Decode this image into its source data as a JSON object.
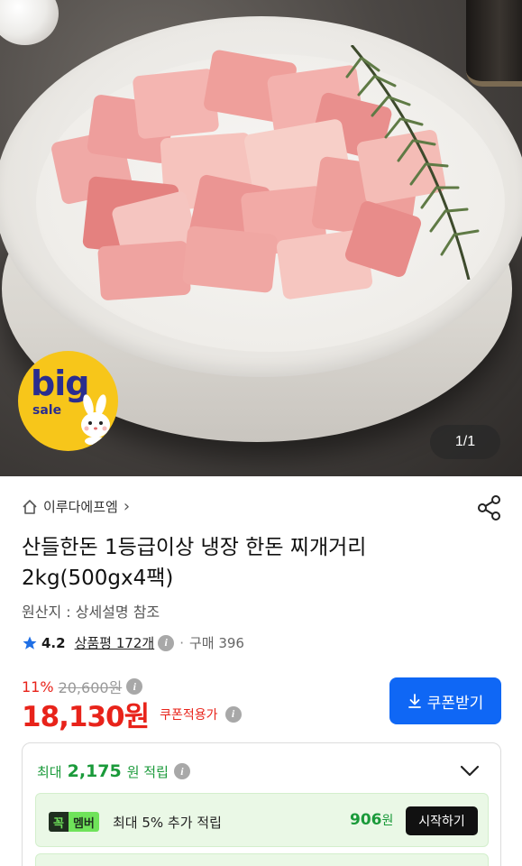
{
  "hero": {
    "badge_big": "big",
    "badge_sale": "sale",
    "image_counter": "1/1"
  },
  "product": {
    "seller": "이루다에프엠",
    "seller_chevron": "›",
    "title": "산들한돈 1등급이상 냉장 한돈 찌개거리 2kg(500gx4팩)",
    "origin": "원산지 : 상세설명 참조",
    "rating": "4.2",
    "reviews": "상품평 172개",
    "purchase_sep": "·",
    "purchases": "구매 396"
  },
  "price": {
    "discount_pct": "11%",
    "original": "20,600원",
    "final": "18,130원",
    "coupon_label": "쿠폰적용가"
  },
  "coupon_button": {
    "label": "쿠폰받기"
  },
  "points": {
    "prefix": "최대",
    "amount": "2,175",
    "unit_text": "원 적립",
    "member_tag_a": "꼭",
    "member_tag_b": "멤버",
    "member_text": "최대 5% 추가 적립",
    "member_amount": "906",
    "member_won": "원",
    "start_label": "시작하기"
  },
  "colors": {
    "accent_red": "#e8231a",
    "brand_blue": "#0f67f5",
    "points_green": "#1a9a3a"
  },
  "icons": [
    "home-icon",
    "share-icon",
    "star-icon",
    "info-icon",
    "download-icon",
    "chevron-down-icon",
    "bunny-icon"
  ]
}
